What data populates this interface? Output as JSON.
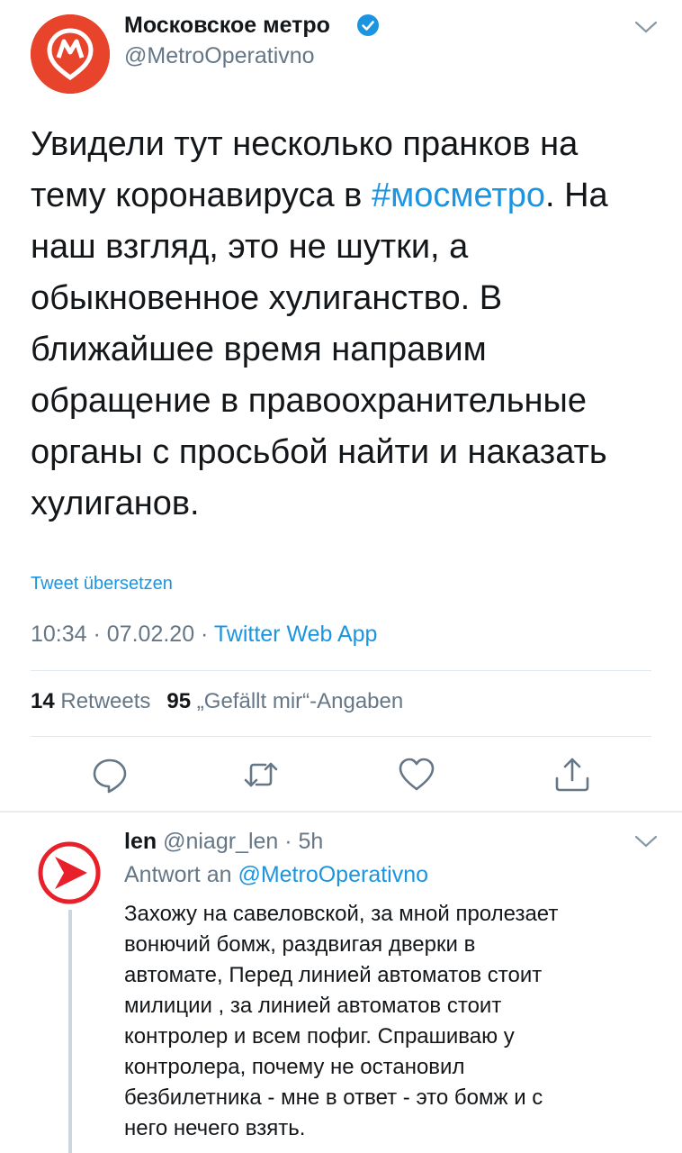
{
  "tweet": {
    "display_name": "Московское метро",
    "handle": "@MetroOperativno",
    "text_before": "Увидели тут несколько пранков на\nтему коронавируса в ",
    "hashtag": "#мосметро",
    "text_after": ". На\nнаш взгляд, это не шутки, а\nобыкновенное хулиганство. В\nближайшее время направим\nобращение в правоохранительные\nорганы с просьбой найти и наказать\nхулиганов.",
    "translate_label": "Tweet übersetzen",
    "time": "10:34",
    "date": "07.02.20",
    "separator": " · ",
    "source": "Twitter Web App",
    "retweets_count": "14",
    "retweets_label": "Retweets",
    "likes_count": "95",
    "likes_label": "„Gefällt mir“-Angaben"
  },
  "actions": {
    "reply": "reply-icon",
    "retweet": "retweet-icon",
    "like": "heart-icon",
    "share": "share-icon"
  },
  "reply": {
    "name": "len",
    "handle_time": "@niagr_len · 5h",
    "reply_to_prefix": "Antwort an ",
    "reply_to_handle": "@MetroOperativno",
    "text": "Захожу на савеловской, за мной пролезает\nвонючий бомж, раздвигая дверки в\nавтомате, Перед линией автоматов стоит\nмилиции , за линией автоматов стоит\nконтролер и всем пофиг. Спрашиваю у\nконтролера, почему не остановил\nбезбилетника - мне в ответ - это бомж и с\nнего нечего взять."
  },
  "colors": {
    "accent": "#1b95e0",
    "metro_red": "#e8432b",
    "secondary_text": "#657786",
    "divider": "#e1e8ed"
  }
}
